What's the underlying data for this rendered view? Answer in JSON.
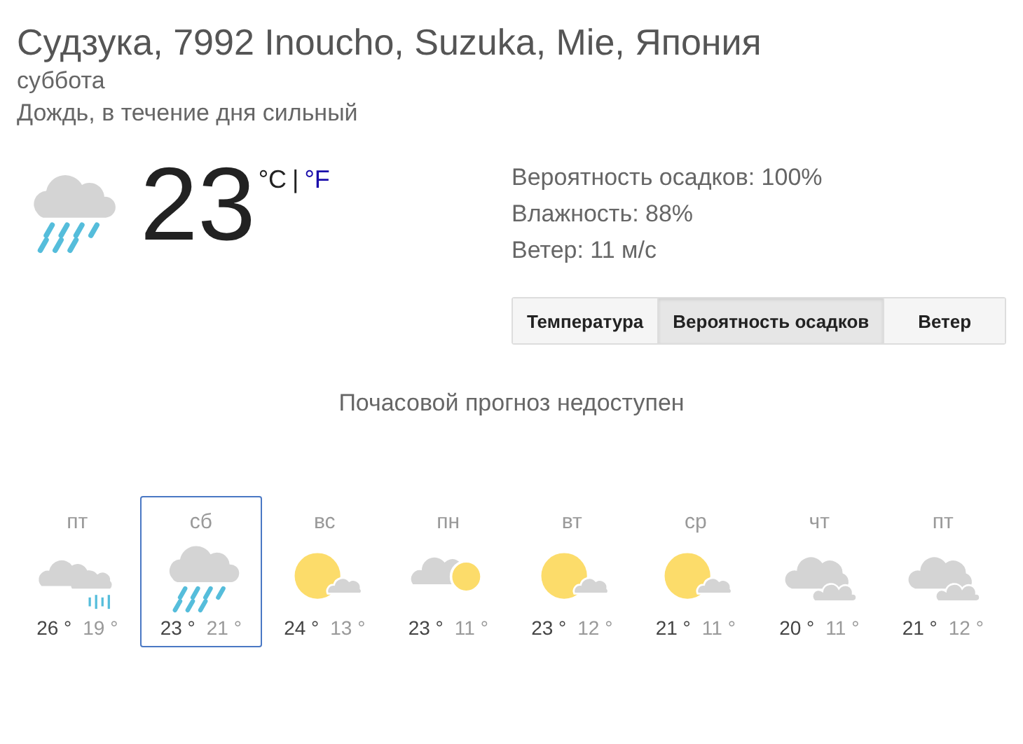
{
  "location": "Судзука, 7992 Inoucho, Suzuka, Mie, Япония",
  "day": "суббота",
  "condition": "Дождь, в течение дня сильный",
  "current": {
    "kind": "rain",
    "temperature": "23",
    "units": [
      {
        "label": "°C",
        "selected": true
      },
      {
        "label": "°F",
        "selected": false
      }
    ],
    "separator": "|"
  },
  "details": [
    "Вероятность осадков: 100%",
    "Влажность: 88%",
    "Ветер: 11 м/с"
  ],
  "tabs": [
    {
      "label": "Температура",
      "selected": false
    },
    {
      "label": "Вероятность осадков",
      "selected": true
    },
    {
      "label": "Ветер",
      "selected": false
    }
  ],
  "hourly_message": "Почасовой прогноз недоступен",
  "days": [
    {
      "day": "пт",
      "kind": "showers",
      "high": "26 °",
      "low": "19 °",
      "selected": false
    },
    {
      "day": "сб",
      "kind": "rain",
      "high": "23 °",
      "low": "21 °",
      "selected": true
    },
    {
      "day": "вс",
      "kind": "sun-cloud",
      "high": "24 °",
      "low": "13 °",
      "selected": false
    },
    {
      "day": "пн",
      "kind": "cloud-sun",
      "high": "23 °",
      "low": "11 °",
      "selected": false
    },
    {
      "day": "вт",
      "kind": "sun-cloud",
      "high": "23 °",
      "low": "12 °",
      "selected": false
    },
    {
      "day": "ср",
      "kind": "sun-cloud",
      "high": "21 °",
      "low": "11 °",
      "selected": false
    },
    {
      "day": "чт",
      "kind": "clouds",
      "high": "20 °",
      "low": "11 °",
      "selected": false
    },
    {
      "day": "пт",
      "kind": "clouds",
      "high": "21 °",
      "low": "12 °",
      "selected": false
    }
  ]
}
